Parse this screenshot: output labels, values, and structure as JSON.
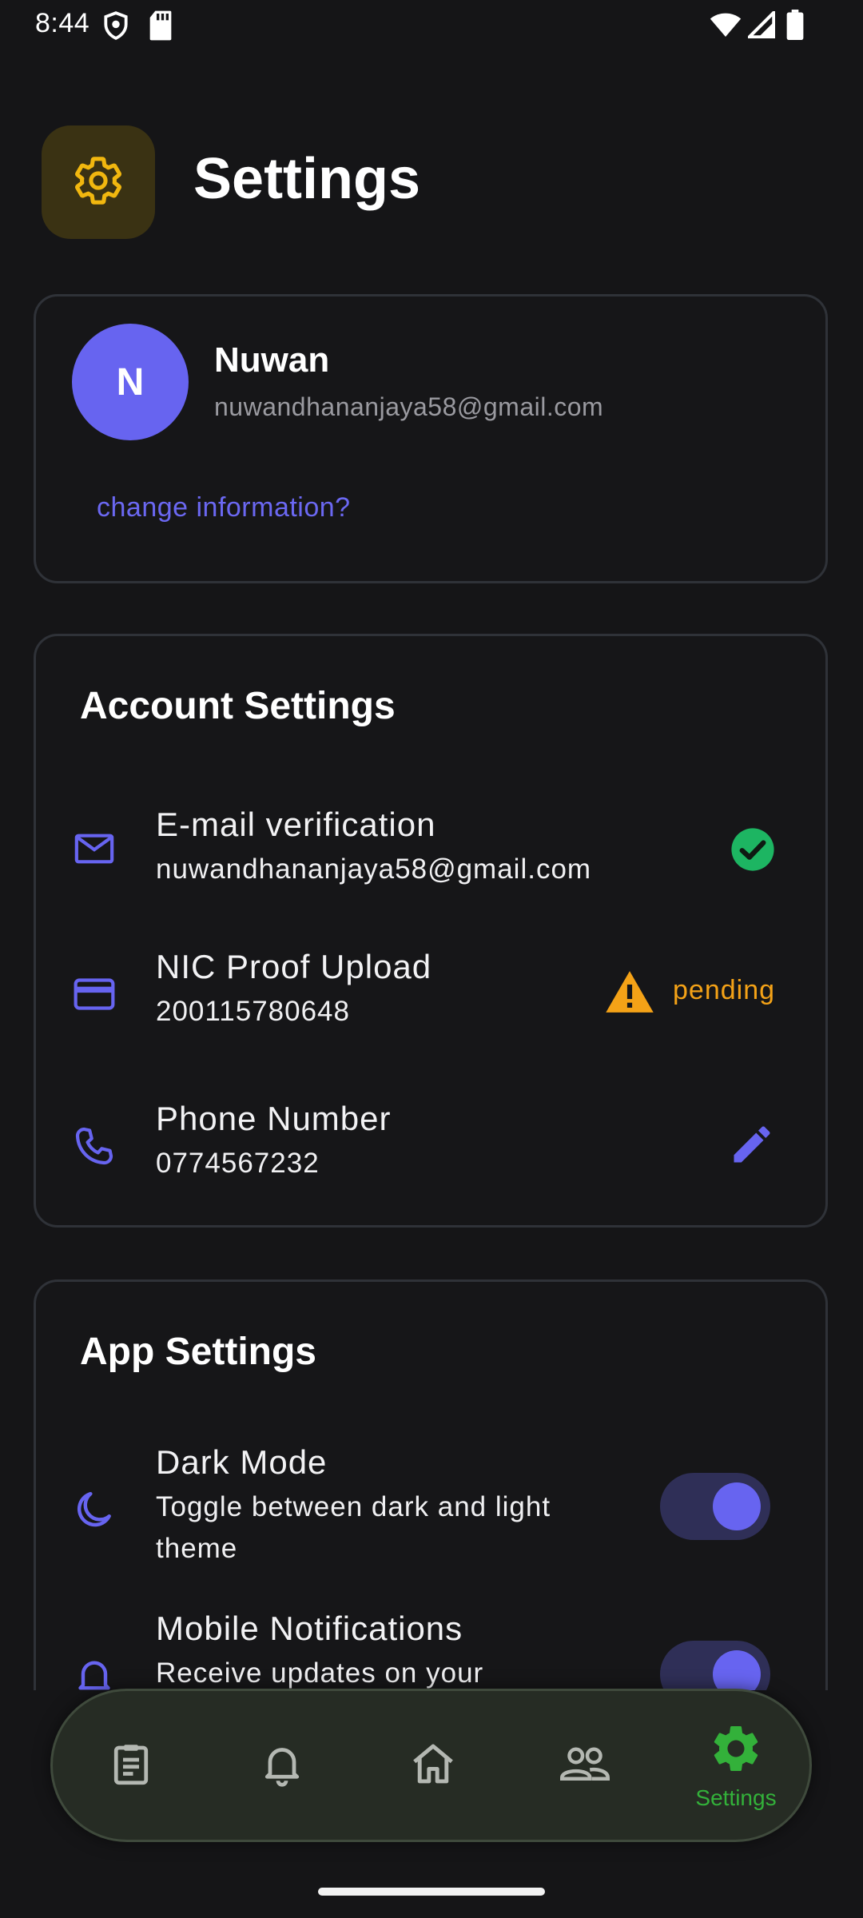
{
  "status_bar": {
    "time": "8:44"
  },
  "header": {
    "title": "Settings",
    "icon": "gear-icon"
  },
  "profile": {
    "initial": "N",
    "name": "Nuwan",
    "email": "nuwandhananjaya58@gmail.com",
    "change_link": "change information?"
  },
  "account_settings": {
    "title": "Account Settings",
    "items": [
      {
        "icon": "mail-icon",
        "title": "E-mail verification",
        "value": "nuwandhananjaya58@gmail.com",
        "status": "verified",
        "status_icon": "check-circle-icon"
      },
      {
        "icon": "credit-card-icon",
        "title": "NIC Proof Upload",
        "value": "200115780648",
        "status": "pending",
        "status_icon": "warning-icon"
      },
      {
        "icon": "phone-icon",
        "title": "Phone Number",
        "value": "0774567232",
        "action_icon": "edit-pencil-icon"
      }
    ]
  },
  "app_settings": {
    "title": "App Settings",
    "items": [
      {
        "icon": "moon-icon",
        "title": "Dark Mode",
        "description": "Toggle between dark and light theme",
        "enabled": true
      },
      {
        "icon": "bell-icon",
        "title": "Mobile Notifications",
        "description": "Receive updates on your",
        "enabled": true
      }
    ]
  },
  "bottom_nav": {
    "items": [
      {
        "icon": "clipboard-icon",
        "label": ""
      },
      {
        "icon": "bell-icon",
        "label": ""
      },
      {
        "icon": "home-icon",
        "label": ""
      },
      {
        "icon": "people-icon",
        "label": ""
      },
      {
        "icon": "gear-icon",
        "label": "Settings",
        "active": true
      }
    ]
  },
  "colors": {
    "background": "#151517",
    "accent": "#6764f0",
    "verified": "#1db562",
    "pending": "#f4a217",
    "nav_active": "#33b13a",
    "settings_icon": "#f1b70f"
  }
}
